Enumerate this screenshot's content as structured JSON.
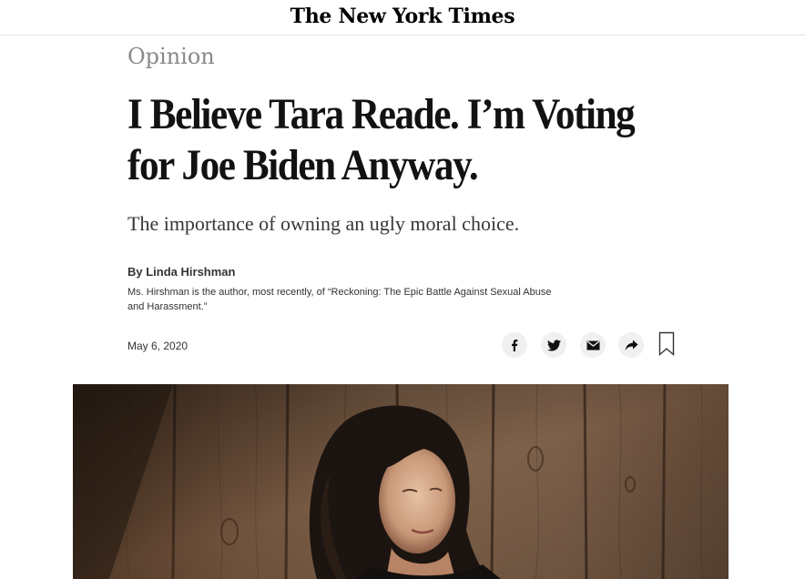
{
  "masthead": {
    "logo_text": "The New York Times"
  },
  "article": {
    "kicker": "Opinion",
    "headline": "I Believe Tara Reade. I’m Voting for Joe Biden Anyway.",
    "summary": "The importance of owning an ugly moral choice.",
    "byline": "By Linda Hirshman",
    "bio": "Ms. Hirshman is the author, most recently, of “Reckoning: The Epic Battle Against Sexual Abuse and Harassment.”",
    "date": "May 6, 2020"
  },
  "share_tools": {
    "icons": [
      "facebook-icon",
      "twitter-icon",
      "email-icon",
      "share-icon",
      "bookmark-icon"
    ]
  },
  "colors": {
    "kicker": "#8a8a8a",
    "headline": "#121212",
    "button_bg": "#f0f0f0",
    "photo_wood": "#8a6a50"
  }
}
